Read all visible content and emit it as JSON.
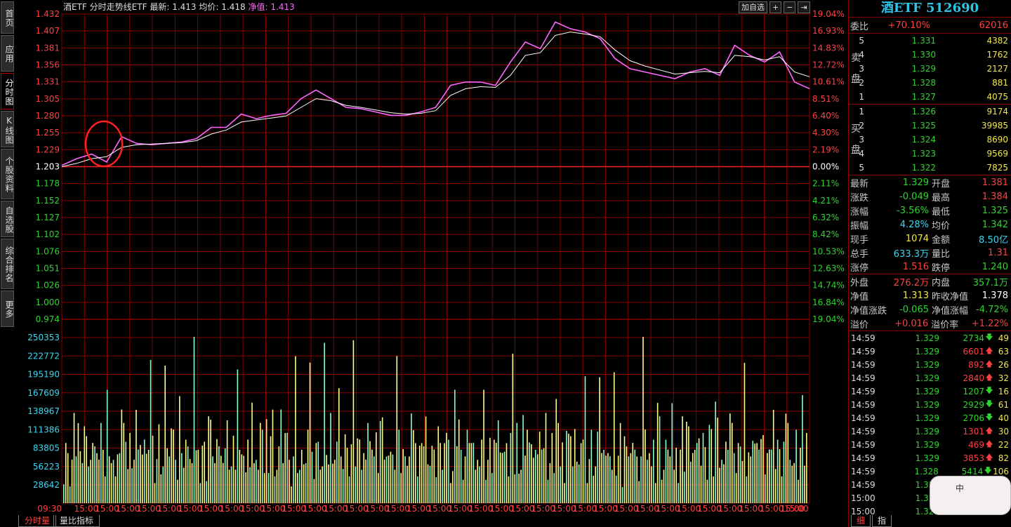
{
  "sidebar": {
    "tabs": [
      {
        "label": "首页",
        "active": false
      },
      {
        "label": "应用",
        "active": false
      },
      {
        "label": "分时图",
        "active": true
      },
      {
        "label": "K线图",
        "active": false
      },
      {
        "label": "个股资料",
        "active": false
      },
      {
        "label": "自选股",
        "active": false
      },
      {
        "label": "综合排名",
        "active": false
      },
      {
        "label": "更多",
        "active": false
      }
    ]
  },
  "header": {
    "name": "酒ETF",
    "chart_kind": "分时走势线ETF",
    "latest_label": "最新:",
    "latest_value": "1.413",
    "avg_label": "均价:",
    "avg_value": "1.418",
    "nav_label": "净值:",
    "nav_value": "1.413",
    "add_watch": "加自选",
    "zoom_in": "+",
    "zoom_out": "−",
    "exit": "⇥"
  },
  "chart_data": {
    "type": "line",
    "price_ticks": [
      "1.432",
      "1.407",
      "1.381",
      "1.356",
      "1.331",
      "1.305",
      "1.280",
      "1.255",
      "1.229",
      "1.203",
      "1.178",
      "1.152",
      "1.127",
      "1.102",
      "1.076",
      "1.051",
      "1.026",
      "1.000",
      "0.974"
    ],
    "pct_ticks": [
      "19.04%",
      "16.93%",
      "14.83%",
      "12.72%",
      "10.61%",
      "8.51%",
      "6.40%",
      "4.30%",
      "2.19%",
      "0.00%",
      "2.11%",
      "4.21%",
      "6.32%",
      "8.42%",
      "10.53%",
      "12.63%",
      "14.74%",
      "16.84%",
      "19.04%"
    ],
    "volume_ticks": [
      "250353",
      "222772",
      "195190",
      "167609",
      "138967",
      "111386",
      "83805",
      "56223",
      "28642"
    ],
    "time_labels": [
      "09:30",
      "15:00",
      "15:00",
      "15:00",
      "15:00",
      "15:00",
      "15:00",
      "15:00",
      "15:00",
      "15:00",
      "15:00",
      "15:00",
      "15:00",
      "15:00",
      "15:00",
      "15:00",
      "15:00",
      "15:00",
      "15:00",
      "15:00",
      "15:00",
      "15:00",
      "15:00",
      "15:00",
      "15:00",
      "15:00",
      "15:00",
      "15:00",
      "15:00",
      "15:00",
      "15:00",
      "15:00",
      "15:00",
      "15:00",
      "15:00",
      "15:00",
      "15:00"
    ],
    "ylim": [
      0.974,
      1.432
    ],
    "base_price": 1.203,
    "series": [
      {
        "values": [
          1.205,
          1.215,
          1.222,
          1.21,
          1.248,
          1.238,
          1.236,
          1.238,
          1.24,
          1.245,
          1.262,
          1.262,
          1.282,
          1.275,
          1.28,
          1.283,
          1.305,
          1.318,
          1.305,
          1.292,
          1.29,
          1.285,
          1.28,
          1.28,
          1.285,
          1.292,
          1.325,
          1.33,
          1.33,
          1.325,
          1.36,
          1.39,
          1.38,
          1.42,
          1.41,
          1.405,
          1.395,
          1.365,
          1.35,
          1.345,
          1.34,
          1.335,
          1.345,
          1.35,
          1.34,
          1.385,
          1.37,
          1.36,
          1.375,
          1.33,
          1.32
        ]
      },
      {
        "values": [
          1.203,
          1.208,
          1.215,
          1.218,
          1.232,
          1.236,
          1.237,
          1.238,
          1.239,
          1.242,
          1.252,
          1.258,
          1.27,
          1.273,
          1.276,
          1.279,
          1.292,
          1.305,
          1.302,
          1.295,
          1.292,
          1.288,
          1.284,
          1.282,
          1.283,
          1.287,
          1.31,
          1.32,
          1.323,
          1.322,
          1.34,
          1.37,
          1.374,
          1.4,
          1.405,
          1.402,
          1.398,
          1.378,
          1.362,
          1.354,
          1.348,
          1.342,
          1.344,
          1.346,
          1.344,
          1.37,
          1.368,
          1.363,
          1.368,
          1.345,
          1.338
        ]
      }
    ],
    "volumes": [
      14,
      70,
      35,
      20,
      40,
      90,
      60,
      30,
      28,
      45,
      80,
      100,
      35,
      25,
      40,
      60,
      30,
      55,
      90,
      30,
      25,
      50,
      70,
      40,
      25,
      35,
      48,
      30,
      60,
      90,
      42,
      36,
      70,
      52,
      45,
      30,
      75,
      62,
      28,
      85,
      44,
      30,
      92,
      66,
      30,
      46,
      78,
      38,
      30,
      58,
      72,
      40,
      62,
      95,
      30,
      35,
      60,
      35,
      48,
      70,
      40,
      56,
      30,
      88,
      64,
      45,
      30,
      66,
      52,
      28,
      40,
      80,
      60,
      30,
      46,
      70,
      36,
      30,
      62,
      84,
      45,
      30,
      56,
      40,
      70,
      30,
      58,
      36,
      46,
      75
    ],
    "vol_max": 262000,
    "grid": true
  },
  "right_panel": {
    "stock_title": "酒ETF 512690",
    "ratio_label": "委比",
    "ratio_pct": "+70.10%",
    "ratio_diff": "62016",
    "ask_label": "卖盘",
    "bid_label": "买盘",
    "asks": [
      {
        "level": "5",
        "price": "1.331",
        "volume": "4382"
      },
      {
        "level": "4",
        "price": "1.330",
        "volume": "1762"
      },
      {
        "level": "3",
        "price": "1.329",
        "volume": "2127"
      },
      {
        "level": "2",
        "price": "1.328",
        "volume": "881"
      },
      {
        "level": "1",
        "price": "1.327",
        "volume": "4075"
      }
    ],
    "bids": [
      {
        "level": "1",
        "price": "1.326",
        "volume": "9174"
      },
      {
        "level": "2",
        "price": "1.325",
        "volume": "39985"
      },
      {
        "level": "3",
        "price": "1.324",
        "volume": "8690"
      },
      {
        "level": "4",
        "price": "1.323",
        "volume": "9569"
      },
      {
        "level": "5",
        "price": "1.322",
        "volume": "7825"
      }
    ],
    "quotes": [
      {
        "l1": "最新",
        "v1": "1.329",
        "c1": "green",
        "l2": "开盘",
        "v2": "1.381",
        "c2": "red"
      },
      {
        "l1": "涨跌",
        "v1": "-0.049",
        "c1": "green",
        "l2": "最高",
        "v2": "1.384",
        "c2": "red"
      },
      {
        "l1": "涨幅",
        "v1": "-3.56%",
        "c1": "green",
        "l2": "最低",
        "v2": "1.325",
        "c2": "green"
      },
      {
        "l1": "振幅",
        "v1": "4.28%",
        "c1": "cyan",
        "l2": "均价",
        "v2": "1.342",
        "c2": "green"
      },
      {
        "l1": "现手",
        "v1": "1074",
        "c1": "yellow",
        "l2": "金额",
        "v2": "8.50亿",
        "c2": "cyan"
      },
      {
        "l1": "总手",
        "v1": "633.3万",
        "c1": "cyan",
        "l2": "量比",
        "v2": "1.31",
        "c2": "red"
      },
      {
        "l1": "涨停",
        "v1": "1.516",
        "c1": "red",
        "l2": "跌停",
        "v2": "1.240",
        "c2": "green"
      }
    ],
    "quotes2": [
      {
        "l1": "外盘",
        "v1": "276.2万",
        "c1": "red",
        "l2": "内盘",
        "v2": "357.1万",
        "c2": "green"
      },
      {
        "l1": "净值",
        "v1": "1.313",
        "c1": "yellow",
        "l2": "昨收净值",
        "v2": "1.378",
        "c2": "white"
      },
      {
        "l1": "净值涨跌",
        "v1": "-0.065",
        "c1": "green",
        "l2": "净值涨幅",
        "v2": "-4.72%",
        "c2": "green"
      },
      {
        "l1": "溢价",
        "v1": "+0.016",
        "c1": "red",
        "l2": "溢价率",
        "v2": "+1.22%",
        "c2": "red"
      }
    ],
    "trades": [
      {
        "time": "14:59",
        "price": "1.329",
        "vol": "2734",
        "dir": "down",
        "num": "49"
      },
      {
        "time": "14:59",
        "price": "1.329",
        "vol": "6601",
        "dir": "up",
        "num": "63"
      },
      {
        "time": "14:59",
        "price": "1.329",
        "vol": "892",
        "dir": "up",
        "num": "26"
      },
      {
        "time": "14:59",
        "price": "1.329",
        "vol": "2840",
        "dir": "up",
        "num": "32"
      },
      {
        "time": "14:59",
        "price": "1.329",
        "vol": "1207",
        "dir": "down",
        "num": "16"
      },
      {
        "time": "14:59",
        "price": "1.329",
        "vol": "2929",
        "dir": "down",
        "num": "61"
      },
      {
        "time": "14:59",
        "price": "1.329",
        "vol": "2706",
        "dir": "down",
        "num": "40"
      },
      {
        "time": "14:59",
        "price": "1.329",
        "vol": "1301",
        "dir": "up",
        "num": "30"
      },
      {
        "time": "14:59",
        "price": "1.329",
        "vol": "469",
        "dir": "up",
        "num": "22"
      },
      {
        "time": "14:59",
        "price": "1.329",
        "vol": "3853",
        "dir": "up",
        "num": "82"
      },
      {
        "time": "14:59",
        "price": "1.328",
        "vol": "5414",
        "dir": "down",
        "num": "106"
      },
      {
        "time": "14:59",
        "price": "1.327",
        "vol": "",
        "dir": "",
        "num": ""
      },
      {
        "time": "15:00",
        "price": "1.326",
        "vol": "",
        "dir": "",
        "num": ""
      },
      {
        "time": "15:00",
        "price": "1.329",
        "vol": "",
        "dir": "",
        "num": ""
      }
    ]
  },
  "bottom_tabs": {
    "tab1": "分时量",
    "tab2": "量比指标"
  },
  "right_bottom_tabs": {
    "tab1": "细",
    "tab2": "指"
  },
  "widget": {
    "text": "中"
  },
  "colors": {
    "grid": "#8a0000",
    "price_line": "#ff66ff",
    "avg_line": "#ffffff",
    "volume": "#ffff88",
    "base_line": "#ff2020"
  }
}
